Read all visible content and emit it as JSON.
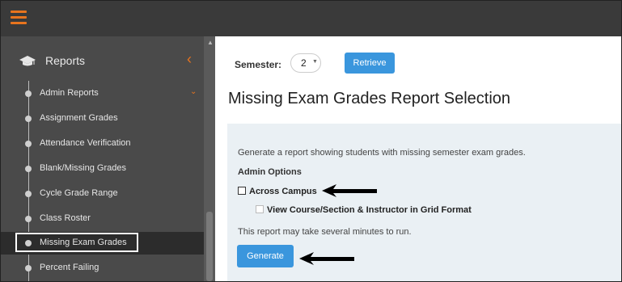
{
  "topbar": {
    "menu_icon": "hamburger-icon",
    "accent": "#e8741e"
  },
  "sidebar": {
    "title": "Reports",
    "header_icon": "graduation-cap-icon",
    "collapse_icon": "chevron-left-icon",
    "items": [
      {
        "label": "Admin Reports"
      },
      {
        "label": "Assignment Grades"
      },
      {
        "label": "Attendance Verification"
      },
      {
        "label": "Blank/Missing Grades"
      },
      {
        "label": "Cycle Grade Range"
      },
      {
        "label": "Class Roster"
      },
      {
        "label": "Missing Exam Grades"
      },
      {
        "label": "Percent Failing"
      }
    ],
    "active_index": 6
  },
  "main": {
    "semester_label": "Semester:",
    "semester_value": "2",
    "retrieve_label": "Retrieve",
    "title": "Missing Exam Grades Report Selection",
    "description": "Generate a report showing students with missing semester exam grades.",
    "admin_options_label": "Admin Options",
    "options": [
      {
        "label": "Across Campus",
        "checked": false
      },
      {
        "label": "View Course/Section & Instructor in Grid Format",
        "checked": false
      }
    ],
    "note": "This report may take several minutes to run.",
    "generate_label": "Generate",
    "button_color": "#3a96dd"
  }
}
